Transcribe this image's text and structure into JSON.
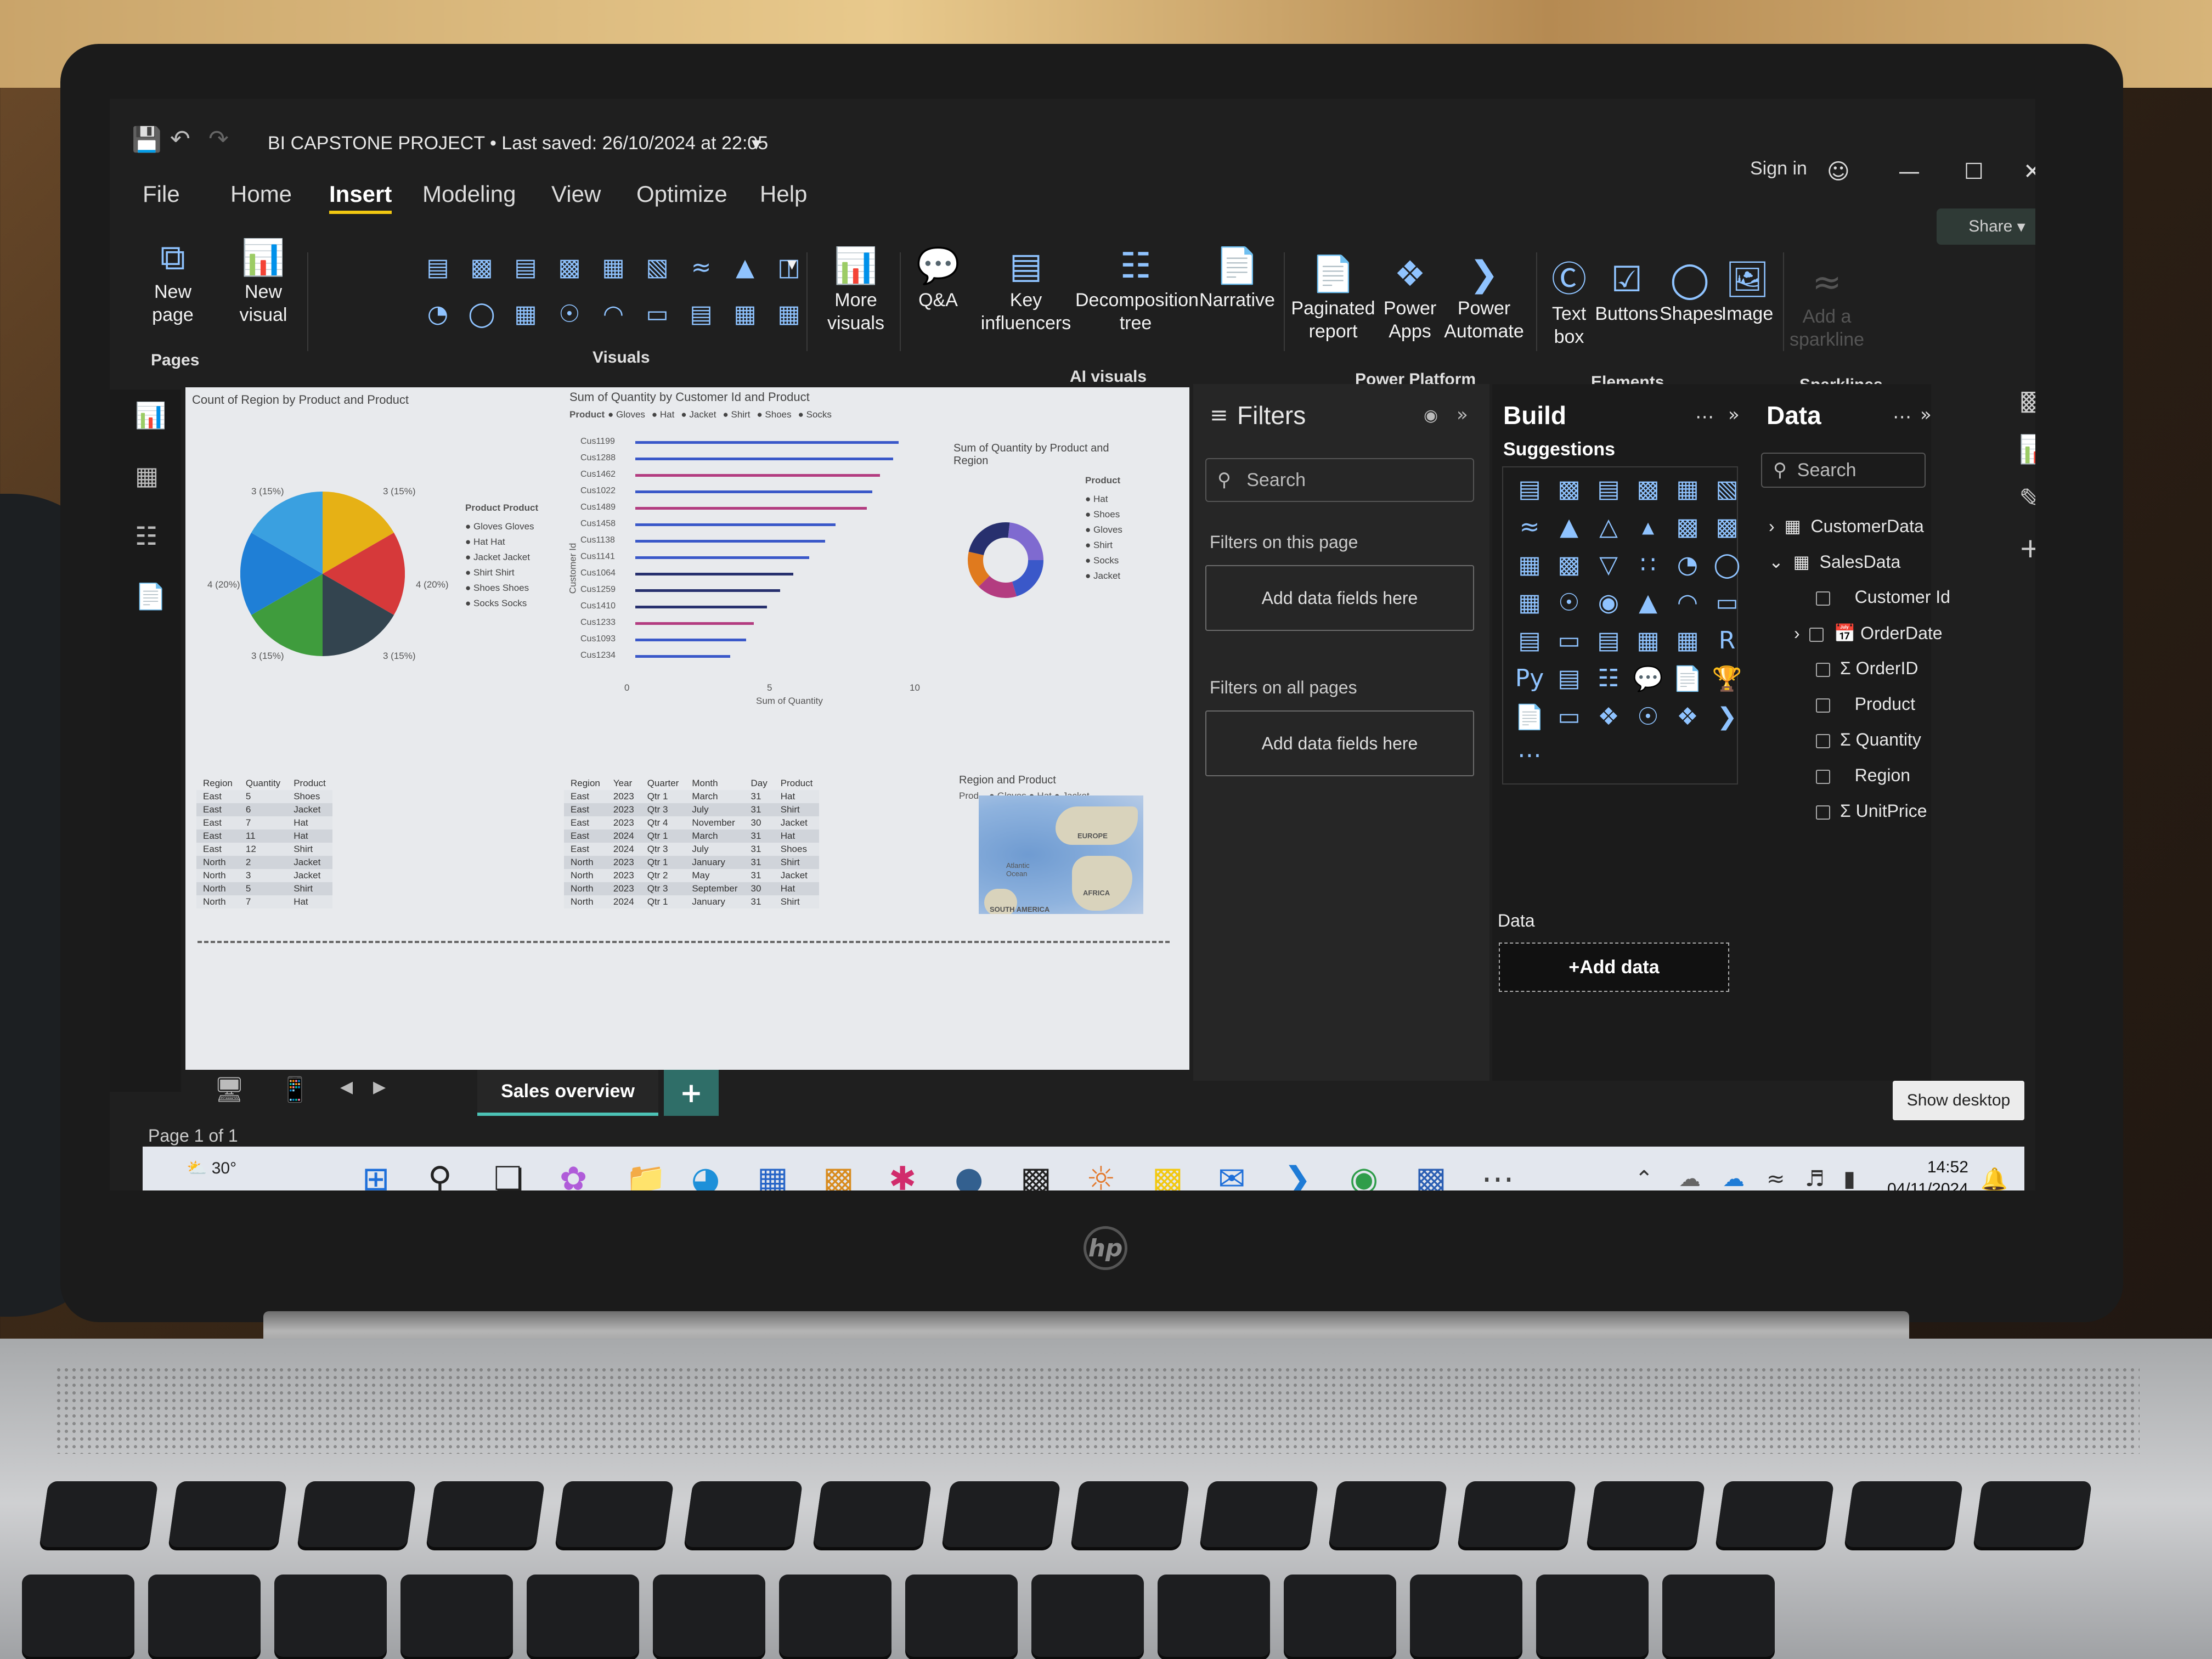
{
  "window": {
    "title": "BI CAPSTONE PROJECT • Last saved: 26/10/2024 at 22:05",
    "sign_in": "Sign in",
    "share": "Share"
  },
  "tabs": [
    "File",
    "Home",
    "Insert",
    "Modeling",
    "View",
    "Optimize",
    "Help"
  ],
  "active_tab": "Insert",
  "ribbon": {
    "new_page": "New page",
    "new_visual": "New visual",
    "more_visuals": "More visuals",
    "qa": "Q&A",
    "key_influencers": "Key influencers",
    "decomposition_tree": "Decomposition tree",
    "narrative": "Narrative",
    "paginated_report": "Paginated report",
    "power_apps": "Power Apps",
    "power_automate": "Power Automate",
    "text_box": "Text box",
    "buttons": "Buttons",
    "shapes": "Shapes",
    "image": "Image",
    "add_sparkline": "Add a sparkline",
    "groups": {
      "pages": "Pages",
      "visuals": "Visuals",
      "ai_visuals": "AI visuals",
      "power_platform": "Power Platform",
      "elements": "Elements",
      "sparklines": "Sparklines"
    }
  },
  "canvas": {
    "pie_title": "Count of Region by Product and Product",
    "pie_labels": [
      "3 (15%)",
      "3 (15%)",
      "4 (20%)",
      "4 (20%)",
      "3 (15%)",
      "3 (15%)"
    ],
    "pie_legend_title": "Product  Product",
    "pie_legend": [
      "Gloves Gloves",
      "Hat Hat",
      "Jacket Jacket",
      "Shirt Shirt",
      "Shoes Shoes",
      "Socks Socks"
    ],
    "bar_title": "Sum of Quantity by Customer Id and Product",
    "bar_legend_title": "Product",
    "bar_legend": [
      "Gloves",
      "Hat",
      "Jacket",
      "Shirt",
      "Shoes",
      "Socks"
    ],
    "bar_customers": [
      "Cus1199",
      "Cus1288",
      "Cus1462",
      "Cus1022",
      "Cus1489",
      "Cus1458",
      "Cus1138",
      "Cus1141",
      "Cus1064",
      "Cus1259",
      "Cus1410",
      "Cus1233",
      "Cus1093",
      "Cus1234"
    ],
    "bar_xlabel": "Sum of Quantity",
    "bar_ylabel": "Customer Id",
    "bar_ticks": [
      "0",
      "5",
      "10"
    ],
    "donut_title": "Sum of Quantity by Product and Region",
    "donut_legend_title": "Product",
    "donut_legend": [
      "Hat",
      "Shoes",
      "Gloves",
      "Shirt",
      "Socks",
      "Jacket"
    ],
    "table1_headers": [
      "Region",
      "Quantity",
      "Product"
    ],
    "table1_rows": [
      [
        "East",
        "5",
        "Shoes"
      ],
      [
        "East",
        "6",
        "Jacket"
      ],
      [
        "East",
        "7",
        "Hat"
      ],
      [
        "East",
        "11",
        "Hat"
      ],
      [
        "East",
        "12",
        "Shirt"
      ],
      [
        "North",
        "2",
        "Jacket"
      ],
      [
        "North",
        "3",
        "Jacket"
      ],
      [
        "North",
        "5",
        "Shirt"
      ],
      [
        "North",
        "7",
        "Hat"
      ]
    ],
    "table2_headers": [
      "Region",
      "Year",
      "Quarter",
      "Month",
      "Day",
      "Product"
    ],
    "table2_rows": [
      [
        "East",
        "2023",
        "Qtr 1",
        "March",
        "31",
        "Hat"
      ],
      [
        "East",
        "2023",
        "Qtr 3",
        "July",
        "31",
        "Shirt"
      ],
      [
        "East",
        "2023",
        "Qtr 4",
        "November",
        "30",
        "Jacket"
      ],
      [
        "East",
        "2024",
        "Qtr 1",
        "March",
        "31",
        "Hat"
      ],
      [
        "East",
        "2024",
        "Qtr 3",
        "July",
        "31",
        "Shoes"
      ],
      [
        "North",
        "2023",
        "Qtr 1",
        "January",
        "31",
        "Shirt"
      ],
      [
        "North",
        "2023",
        "Qtr 2",
        "May",
        "31",
        "Jacket"
      ],
      [
        "North",
        "2023",
        "Qtr 3",
        "September",
        "30",
        "Hat"
      ],
      [
        "North",
        "2024",
        "Qtr 1",
        "January",
        "31",
        "Shirt"
      ]
    ],
    "map_title": "Region and Product",
    "map_legend": "Prod... ● Gloves ● Hat ● Jacket",
    "map_labels": [
      "EUROPE",
      "Atlantic Ocean",
      "AFRICA",
      "SOUTH AMERICA"
    ]
  },
  "pages": {
    "tab": "Sales overview",
    "counter": "Page 1 of 1"
  },
  "filters": {
    "title": "Filters",
    "search": "Search",
    "this_page": "Filters on this page",
    "all_pages": "Filters on all pages",
    "dropzone": "Add data fields here"
  },
  "build": {
    "title": "Build",
    "suggestions": "Suggestions",
    "data_label": "Data",
    "add_data": "+Add data"
  },
  "data_pane": {
    "title": "Data",
    "search": "Search",
    "tables": [
      {
        "name": "CustomerData",
        "expanded": false
      },
      {
        "name": "SalesData",
        "expanded": true,
        "fields": [
          "Customer Id",
          "OrderDate",
          "OrderID",
          "Product",
          "Quantity",
          "Region",
          "UnitPrice"
        ]
      }
    ]
  },
  "tooltip": "Show desktop",
  "taskbar": {
    "temperature": "30°",
    "time": "14:52",
    "date": "04/11/2024"
  },
  "colors": {
    "accent": "#f2c811",
    "page_tab": "#4cc2b5",
    "icon_blue": "#8fc3ff"
  }
}
